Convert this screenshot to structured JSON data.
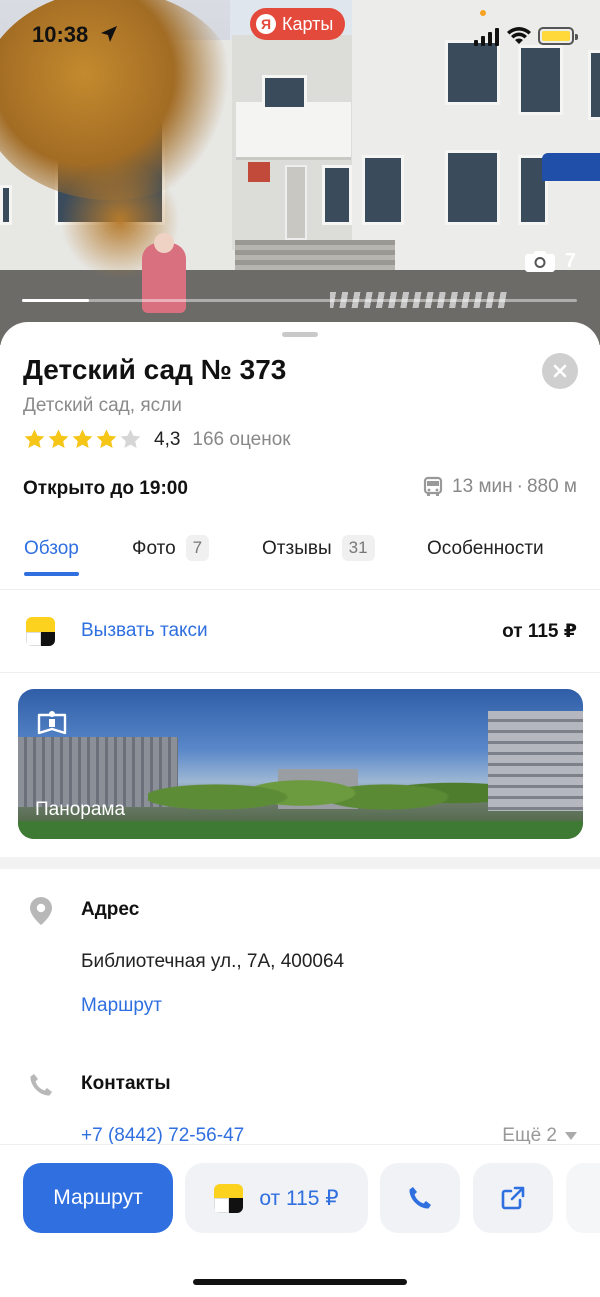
{
  "status_bar": {
    "time": "10:38",
    "app_pill": "Карты",
    "app_pill_logo": "Я",
    "battery_color": "#ffd83a"
  },
  "hero": {
    "photo_count": "7",
    "photo_progress": 0.12,
    "camera_icon": "camera-icon"
  },
  "place": {
    "title": "Детский сад № 373",
    "category": "Детский сад, ясли",
    "rating_value": "4,3",
    "rating_stars": 4.3,
    "rating_count": "166 оценок",
    "open_status": "Открыто до 19:00",
    "transit_time": "13 мин",
    "transit_dot": "·",
    "transit_distance": "880 м"
  },
  "tabs": [
    {
      "label": "Обзор",
      "badge": "",
      "active": true
    },
    {
      "label": "Фото",
      "badge": "7",
      "active": false
    },
    {
      "label": "Отзывы",
      "badge": "31",
      "active": false
    },
    {
      "label": "Особенности",
      "badge": "",
      "active": false
    }
  ],
  "taxi_row": {
    "label": "Вызвать такси",
    "price": "от 115 ₽"
  },
  "panorama": {
    "label": "Панорама"
  },
  "address": {
    "heading": "Адрес",
    "value": "Библиотечная ул., 7А, 400064",
    "route_link": "Маршрут"
  },
  "contacts": {
    "heading": "Контакты",
    "phone": "+7 (8442) 72-56-47",
    "more": "Ещё 2"
  },
  "bottom_bar": {
    "route_button": "Маршрут",
    "taxi_button": "от 115 ₽",
    "call_icon": "phone-icon",
    "share_icon": "share-icon"
  },
  "colors": {
    "accent": "#2f6fe0",
    "star": "#f5c518",
    "taxi_yellow": "#fcd21f",
    "brand_red": "#e44a3b"
  }
}
